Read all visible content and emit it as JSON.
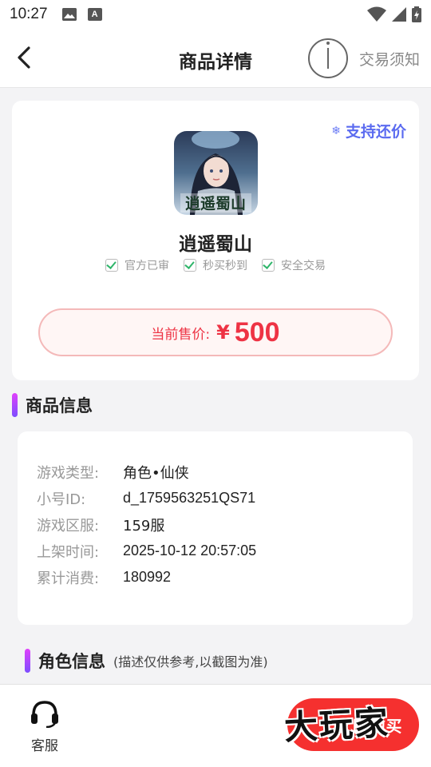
{
  "status_bar": {
    "time": "10:27",
    "icons": [
      "image-icon",
      "font-icon",
      "wifi-icon",
      "signal-icon",
      "battery-icon"
    ],
    "font_icon_letter": "A"
  },
  "header": {
    "title": "商品详情",
    "notice_label": "交易须知"
  },
  "product": {
    "bargain_label": "支持还价",
    "game_name": "逍遥蜀山",
    "game_icon_text": "逍遥蜀山",
    "features": [
      "官方已审",
      "秒买秒到",
      "安全交易"
    ],
    "price_label": "当前售价:",
    "price_symbol": "¥",
    "price_value": "500"
  },
  "goods_section": {
    "title": "商品信息"
  },
  "goods_info": [
    {
      "label": "游戏类型:",
      "value": "角色•仙侠"
    },
    {
      "label": "小号ID:",
      "value": "d_1759563251QS71"
    },
    {
      "label": "游戏区服:",
      "value": "159服"
    },
    {
      "label": "上架时间:",
      "value": "2025-10-12 20:57:05"
    },
    {
      "label": "累计消费:",
      "value": "180992"
    }
  ],
  "role_section": {
    "title": "角色信息",
    "subtitle": "(描述仅供参考,以截图为准)"
  },
  "bottom_bar": {
    "customer_service_label": "客服",
    "buy_label": "立即购买",
    "watermark_text": "大玩家"
  },
  "colors": {
    "accent_red": "#f5302f",
    "price_red": "#ee3344",
    "bargain_blue": "#5b6bf0",
    "check_green": "#2fb56a"
  }
}
